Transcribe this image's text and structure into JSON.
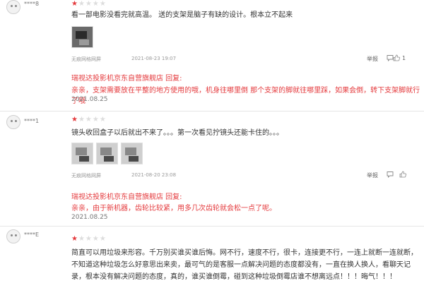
{
  "reviews": [
    {
      "username": "****8",
      "rating": 1,
      "max_rating": 5,
      "content": "看一部电影没看完就高温。 送的支架是脑子有缺的设计。根本立不起来",
      "product": "无痕网格网屏",
      "date": "2021-08-23 19:07",
      "report": "举报",
      "comment_count": "",
      "like_count": "1",
      "reply": {
        "title": "瑞视达投影机京东自营旗舰店 回复:",
        "content": "亲亲，支架需要放在平整的地方使用的哦，机身往哪里倒 那个支架的脚就往哪里踩，如果会倒，转下支架脚就行了哦",
        "date": "2021.08.25"
      }
    },
    {
      "username": "****1",
      "rating": 1,
      "max_rating": 5,
      "content": "镜头收回盒子以后就出不来了。。。第一次看见拧镜头还能卡住的。。。",
      "product": "无痕网格网屏",
      "date": "2021-08-20 23:08",
      "report": "举报",
      "comment_count": "",
      "like_count": "",
      "reply": {
        "title": "瑞视达投影机京东自营旗舰店 回复:",
        "content": "亲亲，由于新机器，齿轮比较紧，用多几次齿轮就会松一点了呢。",
        "date": "2021.08.25"
      }
    },
    {
      "username": "****E",
      "rating": 1,
      "max_rating": 5,
      "content": "简直可以用垃圾来形容。千万别买谁买谁后悔。网不行，速度不行，很卡，连接更不行，一连上就断一连就断，不知道这种垃圾怎么好意思出来卖，最可气的是客服一点解决问题的态度都没有，一直在换人换人，看聊天记录，根本没有解决问题的态度，真的，谁买谁倒霉，碰到这种垃圾倒霉店谁不想离远点！！！晦气！！！"
    }
  ],
  "colors": {
    "accent": "#e4393c",
    "star_off": "#dddddd",
    "muted": "#999999"
  },
  "icons": {
    "report": "none",
    "comment": "comment-bubble-icon",
    "like": "thumbs-up-icon"
  }
}
